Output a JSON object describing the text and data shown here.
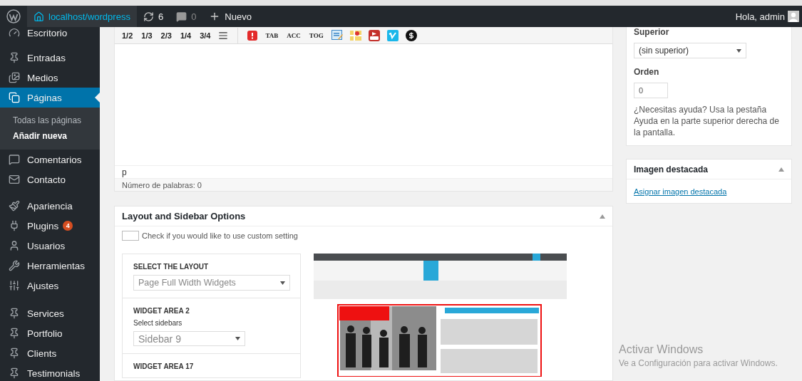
{
  "admin_bar": {
    "site": "localhost/wordpress",
    "updates": "6",
    "comments": "0",
    "new": "Nuevo",
    "greeting": "Hola, admin"
  },
  "sidebar": {
    "groups": [
      [
        {
          "label": "Escritorio",
          "selected": false
        }
      ],
      [
        {
          "label": "Entradas",
          "selected": false
        },
        {
          "label": "Medios",
          "selected": false
        },
        {
          "label": "Páginas",
          "selected": true,
          "children": [
            {
              "label": "Todas las páginas",
              "selected": false
            },
            {
              "label": "Añadir nueva",
              "selected": true
            }
          ]
        },
        {
          "label": "Comentarios",
          "selected": false
        },
        {
          "label": "Contacto",
          "selected": false
        }
      ],
      [
        {
          "label": "Apariencia",
          "selected": false
        },
        {
          "label": "Plugins",
          "selected": false,
          "badge": "4"
        },
        {
          "label": "Usuarios",
          "selected": false
        },
        {
          "label": "Herramientas",
          "selected": false
        },
        {
          "label": "Ajustes",
          "selected": false
        }
      ],
      [
        {
          "label": "Services",
          "selected": false
        },
        {
          "label": "Portfolio",
          "selected": false
        },
        {
          "label": "Clients",
          "selected": false
        },
        {
          "label": "Testimonials",
          "selected": false
        }
      ]
    ]
  },
  "editor": {
    "toolbar": [
      {
        "kind": "text",
        "label": "1/2"
      },
      {
        "kind": "text",
        "label": "1/3"
      },
      {
        "kind": "text",
        "label": "2/3"
      },
      {
        "kind": "text",
        "label": "1/4"
      },
      {
        "kind": "text",
        "label": "3/4"
      },
      {
        "kind": "icon"
      },
      {
        "kind": "divider"
      },
      {
        "kind": "icon"
      },
      {
        "kind": "serif",
        "label": "TAB"
      },
      {
        "kind": "serif",
        "label": "ACC"
      },
      {
        "kind": "serif",
        "label": "TOG"
      },
      {
        "kind": "icon"
      },
      {
        "kind": "icon"
      },
      {
        "kind": "icon"
      },
      {
        "kind": "icon"
      },
      {
        "kind": "icon"
      }
    ],
    "path": "p",
    "word_count": "Número de palabras: 0"
  },
  "layout_box": {
    "title": "Layout and Sidebar Options",
    "checkbox": {
      "label": "Check if you would like to use custom setting",
      "checked": false
    },
    "sections": [
      {
        "heading": "SELECT THE LAYOUT",
        "select": "Page Full Width Widgets"
      },
      {
        "heading": "WIDGET AREA 2",
        "label": "Select sidebars",
        "select": "Sidebar 9"
      },
      {
        "heading": "WIDGET AREA 17"
      }
    ]
  },
  "attributes": {
    "superior_label": "Superior",
    "superior_value": "(sin superior)",
    "order_label": "Orden",
    "order_value": "0",
    "help": "¿Necesitas ayuda? Usa la pestaña Ayuda en la parte superior derecha de la pantalla."
  },
  "featured": {
    "title": "Imagen destacada",
    "link": "Asignar imagen destacada"
  },
  "os_notice": {
    "title": "Activar Windows",
    "subtitle": "Ve a Configuración para activar Windows."
  }
}
